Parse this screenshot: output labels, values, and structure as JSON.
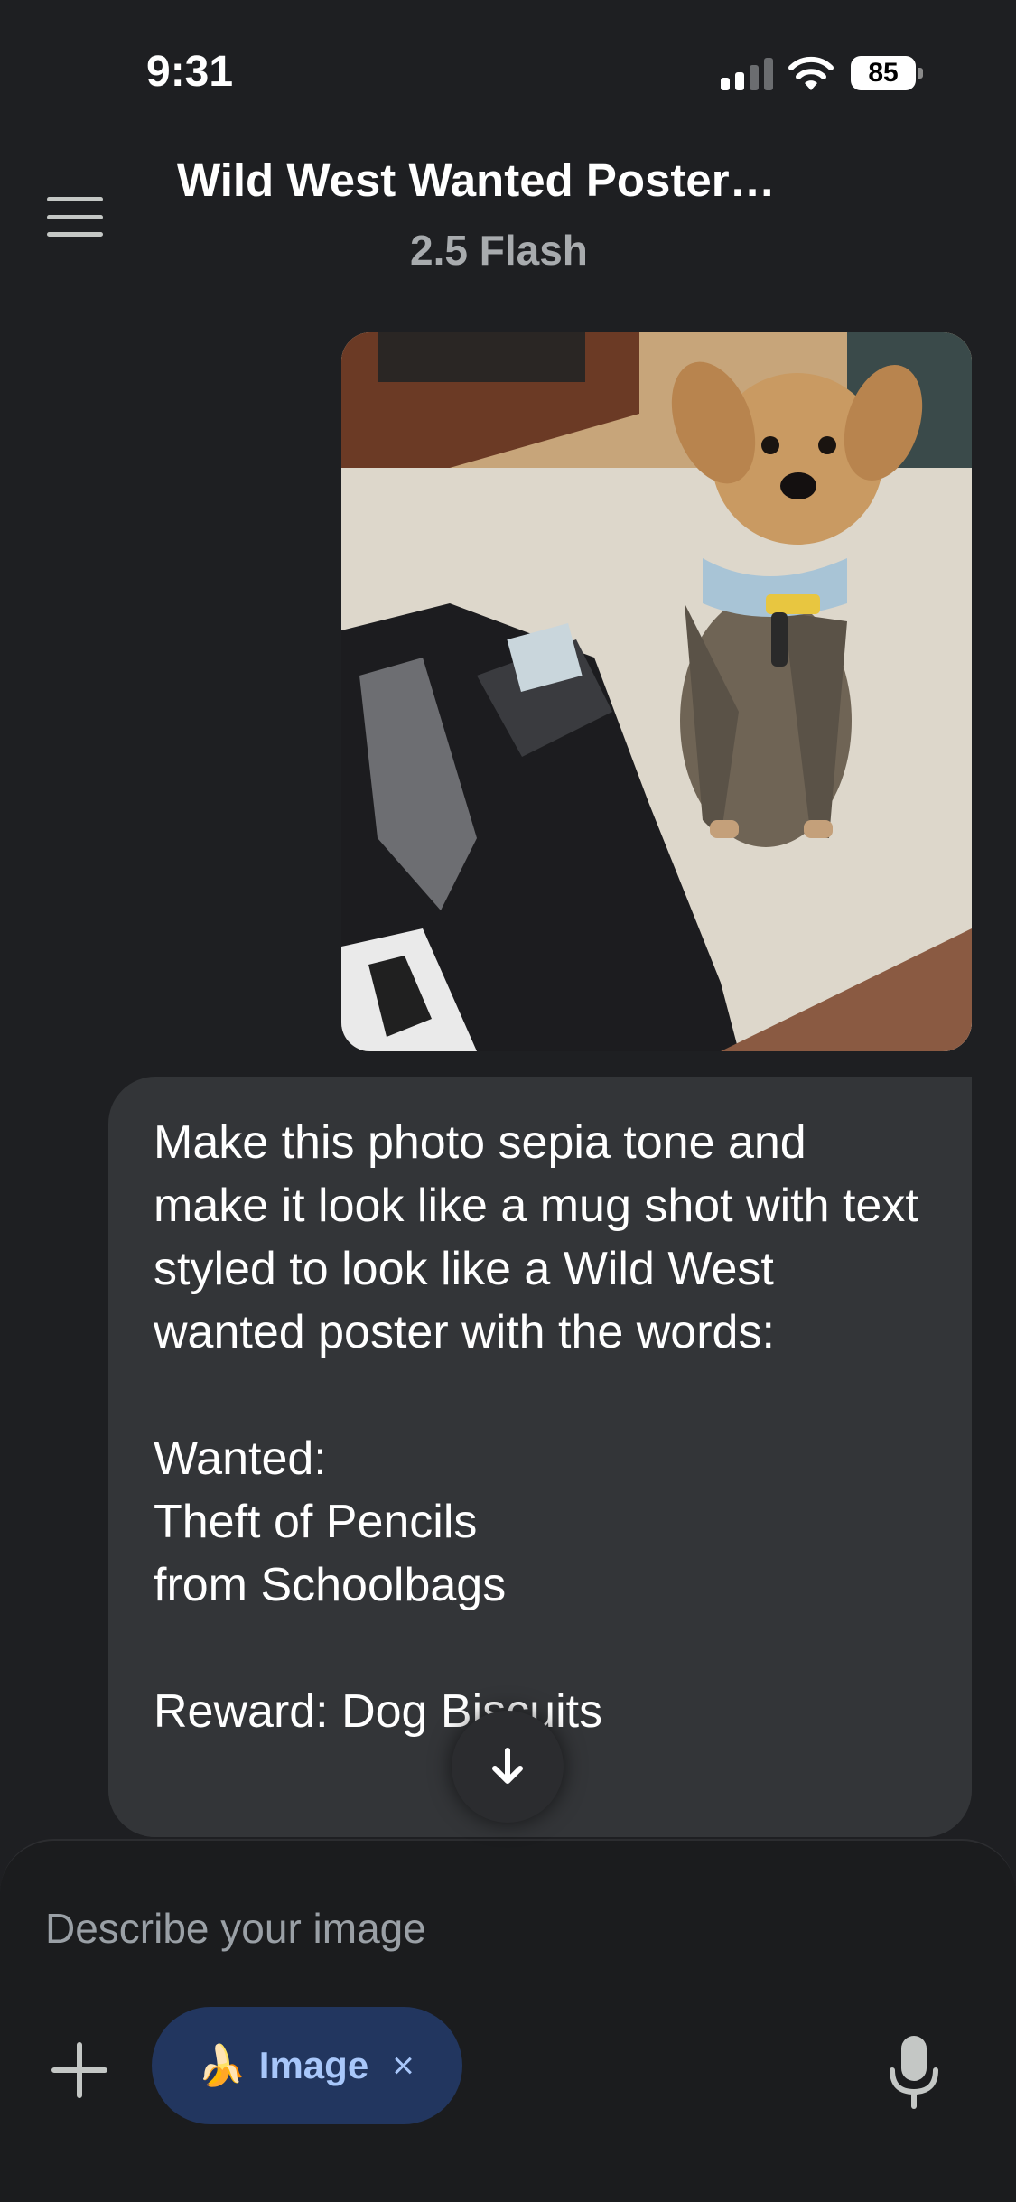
{
  "status_bar": {
    "time": "9:31",
    "battery": "85"
  },
  "header": {
    "title": "Wild West Wanted Poster…",
    "model": "2.5 Flash"
  },
  "conversation": {
    "image_description": "photo of a small tan terrier dog with a harness sitting next to an open black backpack",
    "prompt_text": "Make this photo sepia tone and make it look like a mug shot with text styled to look like a Wild West wanted poster with the words:\n\nWanted:\nTheft of Pencils\nfrom Schoolbags\n\nReward: Dog Biscuits"
  },
  "composer": {
    "placeholder": "Describe your image",
    "tool_chip": {
      "emoji": "🍌",
      "label": "Image",
      "close": "×"
    }
  },
  "icons": [
    "menu-icon",
    "wifi-icon",
    "battery-icon",
    "scroll-down-icon",
    "plus-icon",
    "mic-icon",
    "close-icon"
  ],
  "colors": {
    "background": "#1e1f22",
    "bubble": "#333538",
    "chip_bg": "#22365f",
    "chip_text": "#a8c7fa"
  }
}
